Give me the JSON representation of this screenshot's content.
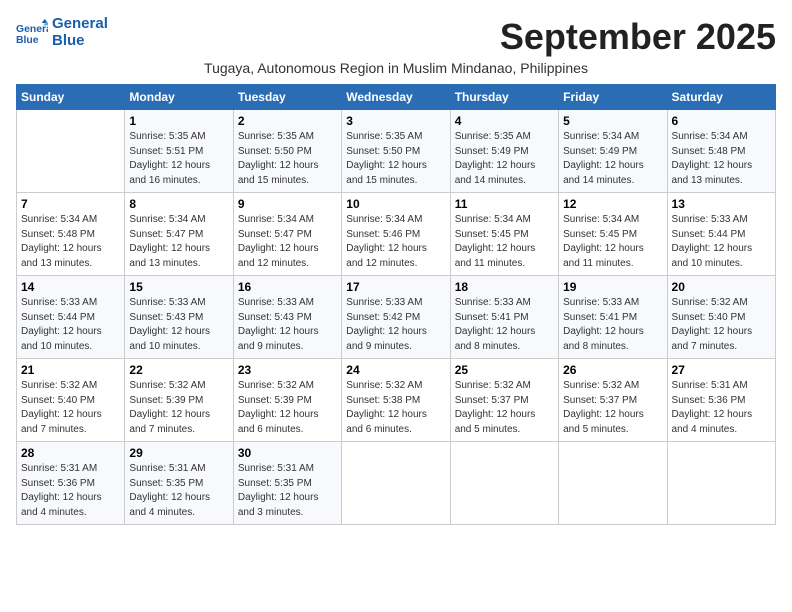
{
  "logo": {
    "line1": "General",
    "line2": "Blue"
  },
  "title": "September 2025",
  "subtitle": "Tugaya, Autonomous Region in Muslim Mindanao, Philippines",
  "headers": [
    "Sunday",
    "Monday",
    "Tuesday",
    "Wednesday",
    "Thursday",
    "Friday",
    "Saturday"
  ],
  "weeks": [
    [
      {
        "day": "",
        "sunrise": "",
        "sunset": "",
        "daylight": ""
      },
      {
        "day": "1",
        "sunrise": "Sunrise: 5:35 AM",
        "sunset": "Sunset: 5:51 PM",
        "daylight": "Daylight: 12 hours and 16 minutes."
      },
      {
        "day": "2",
        "sunrise": "Sunrise: 5:35 AM",
        "sunset": "Sunset: 5:50 PM",
        "daylight": "Daylight: 12 hours and 15 minutes."
      },
      {
        "day": "3",
        "sunrise": "Sunrise: 5:35 AM",
        "sunset": "Sunset: 5:50 PM",
        "daylight": "Daylight: 12 hours and 15 minutes."
      },
      {
        "day": "4",
        "sunrise": "Sunrise: 5:35 AM",
        "sunset": "Sunset: 5:49 PM",
        "daylight": "Daylight: 12 hours and 14 minutes."
      },
      {
        "day": "5",
        "sunrise": "Sunrise: 5:34 AM",
        "sunset": "Sunset: 5:49 PM",
        "daylight": "Daylight: 12 hours and 14 minutes."
      },
      {
        "day": "6",
        "sunrise": "Sunrise: 5:34 AM",
        "sunset": "Sunset: 5:48 PM",
        "daylight": "Daylight: 12 hours and 13 minutes."
      }
    ],
    [
      {
        "day": "7",
        "sunrise": "Sunrise: 5:34 AM",
        "sunset": "Sunset: 5:48 PM",
        "daylight": "Daylight: 12 hours and 13 minutes."
      },
      {
        "day": "8",
        "sunrise": "Sunrise: 5:34 AM",
        "sunset": "Sunset: 5:47 PM",
        "daylight": "Daylight: 12 hours and 13 minutes."
      },
      {
        "day": "9",
        "sunrise": "Sunrise: 5:34 AM",
        "sunset": "Sunset: 5:47 PM",
        "daylight": "Daylight: 12 hours and 12 minutes."
      },
      {
        "day": "10",
        "sunrise": "Sunrise: 5:34 AM",
        "sunset": "Sunset: 5:46 PM",
        "daylight": "Daylight: 12 hours and 12 minutes."
      },
      {
        "day": "11",
        "sunrise": "Sunrise: 5:34 AM",
        "sunset": "Sunset: 5:45 PM",
        "daylight": "Daylight: 12 hours and 11 minutes."
      },
      {
        "day": "12",
        "sunrise": "Sunrise: 5:34 AM",
        "sunset": "Sunset: 5:45 PM",
        "daylight": "Daylight: 12 hours and 11 minutes."
      },
      {
        "day": "13",
        "sunrise": "Sunrise: 5:33 AM",
        "sunset": "Sunset: 5:44 PM",
        "daylight": "Daylight: 12 hours and 10 minutes."
      }
    ],
    [
      {
        "day": "14",
        "sunrise": "Sunrise: 5:33 AM",
        "sunset": "Sunset: 5:44 PM",
        "daylight": "Daylight: 12 hours and 10 minutes."
      },
      {
        "day": "15",
        "sunrise": "Sunrise: 5:33 AM",
        "sunset": "Sunset: 5:43 PM",
        "daylight": "Daylight: 12 hours and 10 minutes."
      },
      {
        "day": "16",
        "sunrise": "Sunrise: 5:33 AM",
        "sunset": "Sunset: 5:43 PM",
        "daylight": "Daylight: 12 hours and 9 minutes."
      },
      {
        "day": "17",
        "sunrise": "Sunrise: 5:33 AM",
        "sunset": "Sunset: 5:42 PM",
        "daylight": "Daylight: 12 hours and 9 minutes."
      },
      {
        "day": "18",
        "sunrise": "Sunrise: 5:33 AM",
        "sunset": "Sunset: 5:41 PM",
        "daylight": "Daylight: 12 hours and 8 minutes."
      },
      {
        "day": "19",
        "sunrise": "Sunrise: 5:33 AM",
        "sunset": "Sunset: 5:41 PM",
        "daylight": "Daylight: 12 hours and 8 minutes."
      },
      {
        "day": "20",
        "sunrise": "Sunrise: 5:32 AM",
        "sunset": "Sunset: 5:40 PM",
        "daylight": "Daylight: 12 hours and 7 minutes."
      }
    ],
    [
      {
        "day": "21",
        "sunrise": "Sunrise: 5:32 AM",
        "sunset": "Sunset: 5:40 PM",
        "daylight": "Daylight: 12 hours and 7 minutes."
      },
      {
        "day": "22",
        "sunrise": "Sunrise: 5:32 AM",
        "sunset": "Sunset: 5:39 PM",
        "daylight": "Daylight: 12 hours and 7 minutes."
      },
      {
        "day": "23",
        "sunrise": "Sunrise: 5:32 AM",
        "sunset": "Sunset: 5:39 PM",
        "daylight": "Daylight: 12 hours and 6 minutes."
      },
      {
        "day": "24",
        "sunrise": "Sunrise: 5:32 AM",
        "sunset": "Sunset: 5:38 PM",
        "daylight": "Daylight: 12 hours and 6 minutes."
      },
      {
        "day": "25",
        "sunrise": "Sunrise: 5:32 AM",
        "sunset": "Sunset: 5:37 PM",
        "daylight": "Daylight: 12 hours and 5 minutes."
      },
      {
        "day": "26",
        "sunrise": "Sunrise: 5:32 AM",
        "sunset": "Sunset: 5:37 PM",
        "daylight": "Daylight: 12 hours and 5 minutes."
      },
      {
        "day": "27",
        "sunrise": "Sunrise: 5:31 AM",
        "sunset": "Sunset: 5:36 PM",
        "daylight": "Daylight: 12 hours and 4 minutes."
      }
    ],
    [
      {
        "day": "28",
        "sunrise": "Sunrise: 5:31 AM",
        "sunset": "Sunset: 5:36 PM",
        "daylight": "Daylight: 12 hours and 4 minutes."
      },
      {
        "day": "29",
        "sunrise": "Sunrise: 5:31 AM",
        "sunset": "Sunset: 5:35 PM",
        "daylight": "Daylight: 12 hours and 4 minutes."
      },
      {
        "day": "30",
        "sunrise": "Sunrise: 5:31 AM",
        "sunset": "Sunset: 5:35 PM",
        "daylight": "Daylight: 12 hours and 3 minutes."
      },
      {
        "day": "",
        "sunrise": "",
        "sunset": "",
        "daylight": ""
      },
      {
        "day": "",
        "sunrise": "",
        "sunset": "",
        "daylight": ""
      },
      {
        "day": "",
        "sunrise": "",
        "sunset": "",
        "daylight": ""
      },
      {
        "day": "",
        "sunrise": "",
        "sunset": "",
        "daylight": ""
      }
    ]
  ]
}
